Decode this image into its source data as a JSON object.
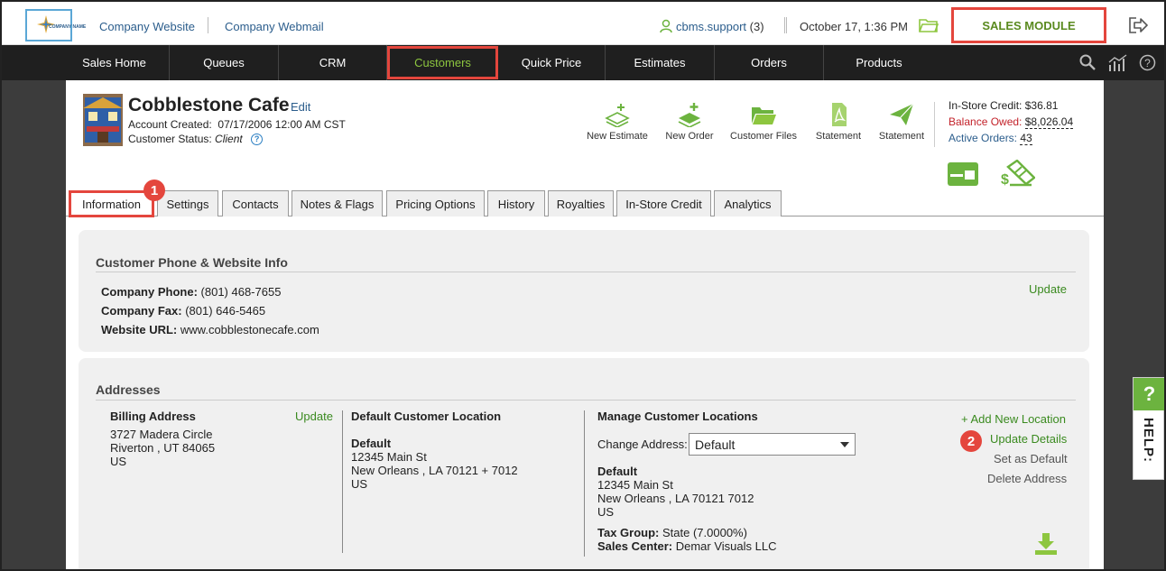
{
  "topbar": {
    "logo_text": "COMPANY NAME",
    "links": [
      "Company Website",
      "Company Webmail"
    ],
    "user": "cbms.support",
    "user_count": "(3)",
    "datetime": "October 17, 1:36 PM",
    "module_button": "SALES MODULE"
  },
  "nav": {
    "items": [
      "Sales Home",
      "Queues",
      "CRM",
      "Customers",
      "Quick Price",
      "Estimates",
      "Orders",
      "Products"
    ],
    "active": "Customers"
  },
  "customer": {
    "name": "Cobblestone Cafe",
    "edit": "Edit",
    "account_created_label": "Account Created:",
    "account_created": "07/17/2006 12:00 AM CST",
    "status_label": "Customer Status:",
    "status": "Client"
  },
  "actions": [
    "New Estimate",
    "New Order",
    "Customer Files",
    "Statement",
    "Statement"
  ],
  "account_info": {
    "credit_label": "In-Store Credit:",
    "credit": "$36.81",
    "balance_label": "Balance Owed:",
    "balance": "$8,026.04",
    "orders_label": "Active Orders:",
    "orders": "43"
  },
  "tabs": [
    "Information",
    "Settings",
    "Contacts",
    "Notes & Flags",
    "Pricing Options",
    "History",
    "Royalties",
    "In-Store Credit",
    "Analytics"
  ],
  "badges": [
    "1",
    "2"
  ],
  "phone_section": {
    "title": "Customer Phone & Website Info",
    "phone_label": "Company Phone:",
    "phone": "(801) 468-7655",
    "fax_label": "Company Fax:",
    "fax": "(801) 646-5465",
    "website_label": "Website URL:",
    "website": "www.cobblestonecafe.com",
    "update": "Update"
  },
  "addresses": {
    "title": "Addresses",
    "billing": {
      "title": "Billing Address",
      "update": "Update",
      "line1": "3727 Madera Circle",
      "line2": "Riverton , UT 84065",
      "line3": "US"
    },
    "default_location": {
      "title": "Default Customer Location",
      "name": "Default",
      "line1": "12345 Main St",
      "line2": "New Orleans , LA 70121 + 7012",
      "line3": "US"
    },
    "manage": {
      "title": "Manage Customer Locations",
      "change_label": "Change Address:",
      "selected": "Default",
      "name": "Default",
      "line1": "12345 Main St",
      "line2": "New Orleans , LA 70121 7012",
      "line3": "US",
      "tax_label": "Tax Group:",
      "tax": "State (7.0000%)",
      "center_label": "Sales Center:",
      "center": "Demar Visuals LLC"
    },
    "links": {
      "add": "+ Add New Location",
      "update": "Update Details",
      "set_default": "Set as Default",
      "delete": "Delete Address"
    }
  },
  "help": {
    "q": "?",
    "label": "HELP:"
  },
  "colors": {
    "accent_green": "#8dc63f",
    "highlight_red": "#e4463d",
    "link_blue": "#2b5d8c",
    "balance_red": "#c3222a"
  }
}
